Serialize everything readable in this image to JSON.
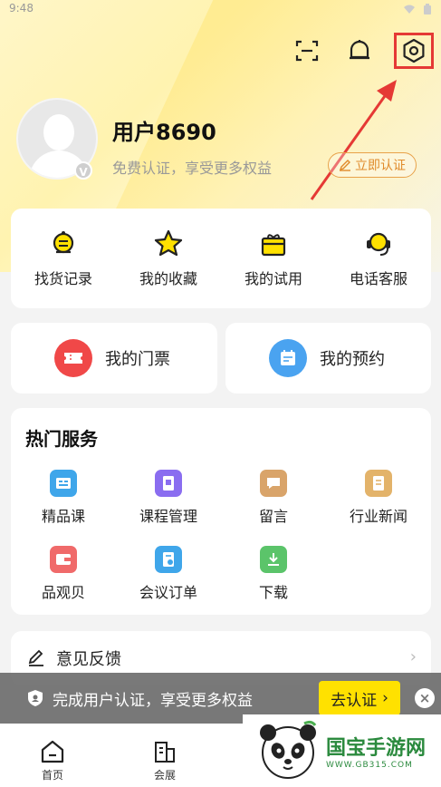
{
  "status_bar": {
    "time": "9:48"
  },
  "profile": {
    "username": "用户8690",
    "subtitle": "免费认证，享受更多权益",
    "verify_button": "立即认证",
    "badge": "V"
  },
  "quick_actions": [
    {
      "label": "找货记录",
      "icon": "search-list-icon"
    },
    {
      "label": "我的收藏",
      "icon": "star-icon"
    },
    {
      "label": "我的试用",
      "icon": "gift-box-icon"
    },
    {
      "label": "电话客服",
      "icon": "headset-icon"
    }
  ],
  "tickets": {
    "label": "我的门票",
    "icon": "ticket-icon",
    "color": "#f04848"
  },
  "bookings": {
    "label": "我的预约",
    "icon": "calendar-icon",
    "color": "#4aa3f0"
  },
  "services": {
    "title": "热门服务",
    "items": [
      {
        "label": "精品课",
        "icon": "course-icon",
        "color": "#3fa6ea"
      },
      {
        "label": "课程管理",
        "icon": "course-manage-icon",
        "color": "#8a6df0"
      },
      {
        "label": "留言",
        "icon": "message-icon",
        "color": "#d9a46a"
      },
      {
        "label": "行业新闻",
        "icon": "news-icon",
        "color": "#e3b36a"
      },
      {
        "label": "品观贝",
        "icon": "wallet-icon",
        "color": "#f06a6a"
      },
      {
        "label": "会议订单",
        "icon": "meeting-order-icon",
        "color": "#3fa6ea"
      },
      {
        "label": "下载",
        "icon": "download-icon",
        "color": "#5bc46a"
      }
    ]
  },
  "feedback": {
    "label": "意见反馈",
    "icon": "edit-icon"
  },
  "banner": {
    "text": "完成用户认证，享受更多权益",
    "button": "去认证",
    "close": "×"
  },
  "tabbar": [
    {
      "label": "首页",
      "icon": "home-icon"
    },
    {
      "label": "会展",
      "icon": "building-icon"
    }
  ],
  "watermark": {
    "title": "国宝手游网",
    "url": "WWW.GB315.COM"
  }
}
